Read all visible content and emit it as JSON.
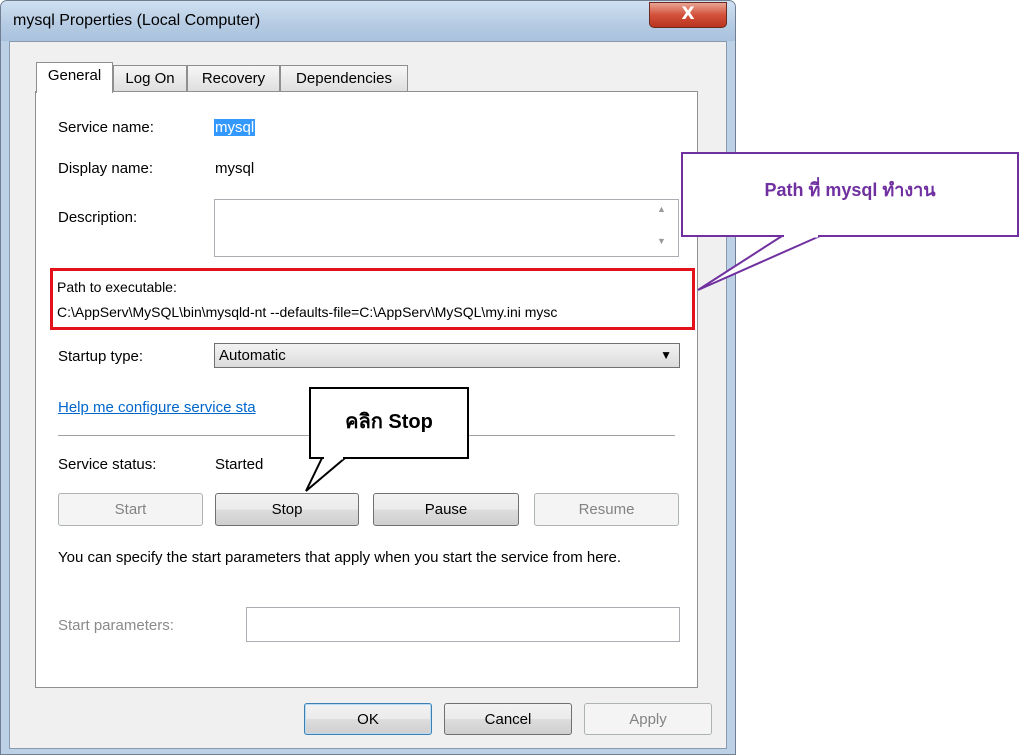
{
  "window": {
    "title": "mysql Properties (Local Computer)",
    "close_symbol": "X"
  },
  "tabs": [
    {
      "label": "General",
      "active": true
    },
    {
      "label": "Log On",
      "active": false
    },
    {
      "label": "Recovery",
      "active": false
    },
    {
      "label": "Dependencies",
      "active": false
    }
  ],
  "general": {
    "service_name_label": "Service name:",
    "service_name_value": "mysql",
    "display_name_label": "Display name:",
    "display_name_value": "mysql",
    "description_label": "Description:",
    "description_value": "",
    "path_label": "Path to executable:",
    "path_value": "C:\\AppServ\\MySQL\\bin\\mysqld-nt --defaults-file=C:\\AppServ\\MySQL\\my.ini mysc",
    "startup_type_label": "Startup type:",
    "startup_type_value": "Automatic",
    "help_link": "Help me configure service sta",
    "service_status_label": "Service status:",
    "service_status_value": "Started",
    "buttons": {
      "start": "Start",
      "stop": "Stop",
      "pause": "Pause",
      "resume": "Resume"
    },
    "start_params_help": "You can specify the start parameters that apply when you start the service from here.",
    "start_params_label": "Start parameters:",
    "start_params_value": ""
  },
  "footer": {
    "ok": "OK",
    "cancel": "Cancel",
    "apply": "Apply"
  },
  "annotations": {
    "path_callout": "Path ที่ mysql ทำงาน",
    "stop_callout": "คลิก Stop"
  },
  "colors": {
    "highlight_border": "#e3111a",
    "path_callout": "#7030a0",
    "link": "#0066cc",
    "selection": "#3399ff"
  }
}
